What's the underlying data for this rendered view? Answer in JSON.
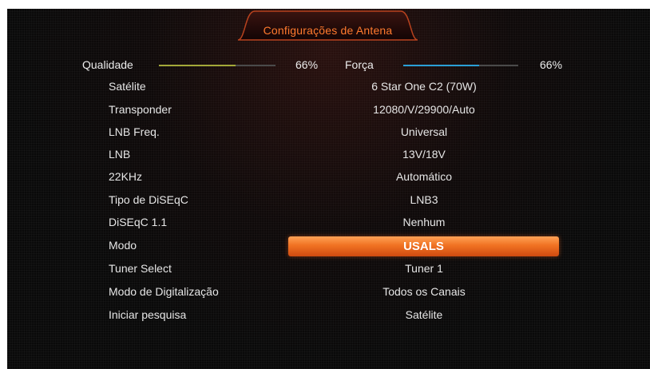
{
  "title": "Configurações de Antena",
  "signal": {
    "quality_label": "Qualidade",
    "quality_value": "66%",
    "quality_fraction": 0.66,
    "strength_label": "Força",
    "strength_value": "66%",
    "strength_fraction": 0.66
  },
  "colors": {
    "quality_bar": "#a3a838",
    "strength_bar": "#2a9fd6",
    "accent": "#f07222",
    "title_text": "#ff7a2e"
  },
  "rows": [
    {
      "label": "Satélite",
      "value": "6 Star One C2  (70W)"
    },
    {
      "label": "Transponder",
      "value": "12080/V/29900/Auto"
    },
    {
      "label": "LNB Freq.",
      "value": "Universal"
    },
    {
      "label": "LNB",
      "value": "13V/18V"
    },
    {
      "label": "22KHz",
      "value": "Automático"
    },
    {
      "label": "Tipo de DiSEqC",
      "value": "LNB3"
    },
    {
      "label": "DiSEqC 1.1",
      "value": "Nenhum"
    },
    {
      "label": "Modo",
      "value": "USALS",
      "selected": true
    },
    {
      "label": "Tuner Select",
      "value": "Tuner 1"
    },
    {
      "label": "Modo de Digitalização",
      "value": "Todos os Canais"
    },
    {
      "label": "Iniciar pesquisa",
      "value": "Satélite"
    }
  ]
}
